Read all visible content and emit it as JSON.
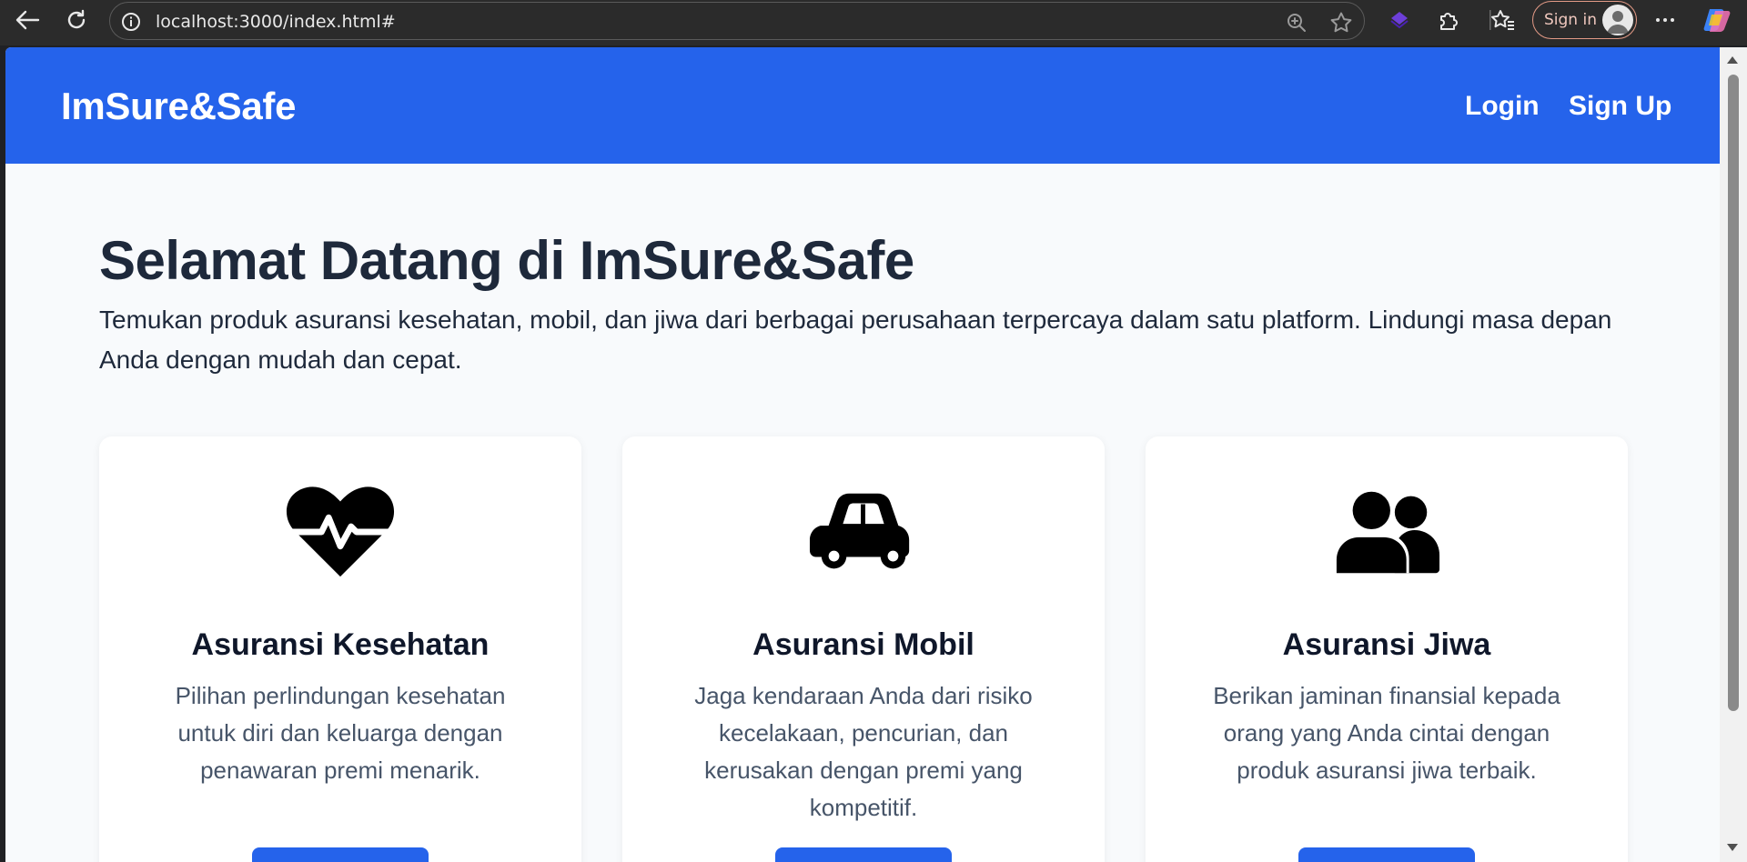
{
  "browser": {
    "url": "localhost:3000/index.html#",
    "sign_in_label": "Sign in"
  },
  "header": {
    "logo": "ImSure&Safe",
    "nav": [
      {
        "label": "Login"
      },
      {
        "label": "Sign Up"
      }
    ]
  },
  "hero": {
    "title": "Selamat Datang di ImSure&Safe",
    "text": "Temukan produk asuransi kesehatan, mobil, dan jiwa dari berbagai perusahaan terpercaya dalam satu platform. Lindungi masa depan Anda dengan mudah dan cepat."
  },
  "cards": [
    {
      "icon": "heart-pulse-icon",
      "title": "Asuransi Kesehatan",
      "description": "Pilihan perlindungan kesehatan untuk diri dan keluarga dengan penawaran premi menarik."
    },
    {
      "icon": "car-icon",
      "title": "Asuransi Mobil",
      "description": "Jaga kendaraan Anda dari risiko kecelakaan, pencurian, dan kerusakan dengan premi yang kompetitif."
    },
    {
      "icon": "users-icon",
      "title": "Asuransi Jiwa",
      "description": "Berikan jaminan finansial kepada orang yang Anda cintai dengan produk asuransi jiwa terbaik."
    }
  ],
  "colors": {
    "brand": "#2563eb",
    "heading": "#1e293b",
    "body_text": "#475569",
    "page_bg": "#f8fafc"
  }
}
